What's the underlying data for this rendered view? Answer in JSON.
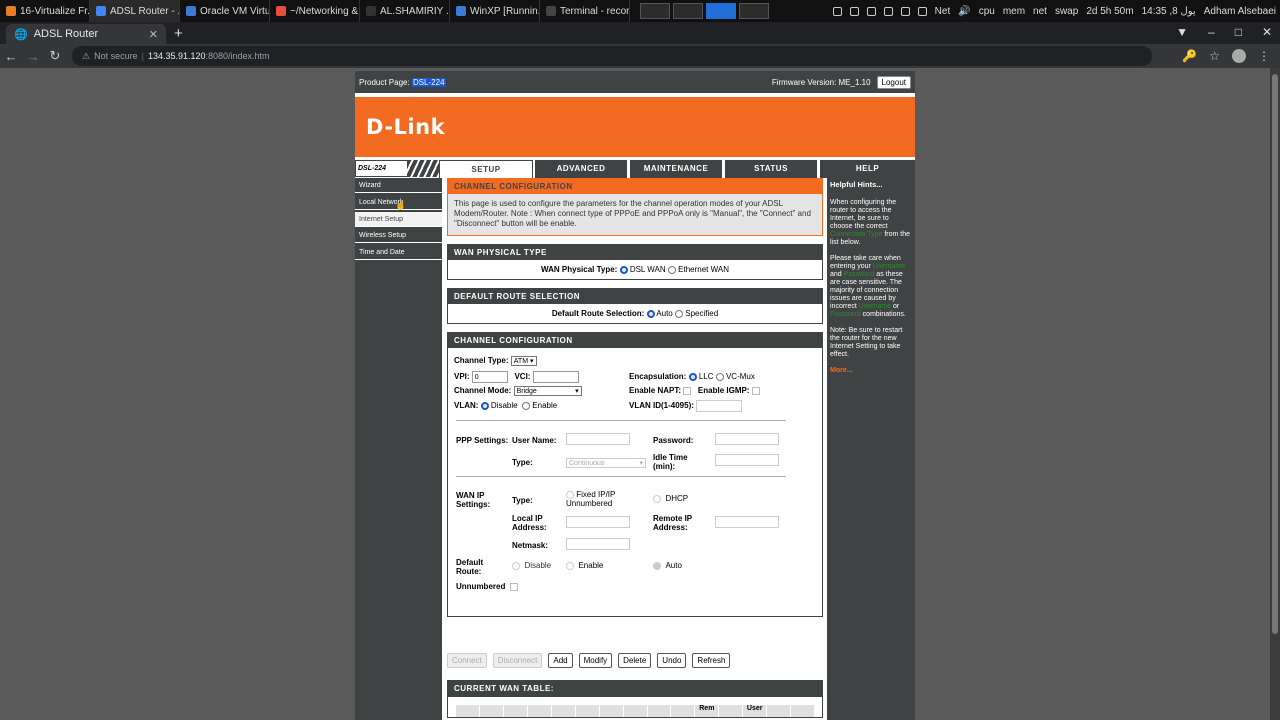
{
  "os_panel": {
    "tasks": [
      {
        "label": "16-Virtualize Fr...",
        "color": "#e67e22"
      },
      {
        "label": "ADSL Router - ...",
        "color": "#4285f4",
        "active": true
      },
      {
        "label": "Oracle VM Virtu...",
        "color": "#3a7bd5"
      },
      {
        "label": "~/Networking &...",
        "color": "#e74c3c"
      },
      {
        "label": "AL.SHAMIRIY ...",
        "color": "#333333"
      },
      {
        "label": "WinXP [Runnin...",
        "color": "#3a7bd5"
      },
      {
        "label": "Terminal - recor...",
        "color": "#444444"
      }
    ],
    "tray": {
      "net": "Net",
      "cpu": "cpu",
      "mem": "mem",
      "net2": "net",
      "swap": "swap",
      "uptime": "2d 5h 50m",
      "clock": "14:35 ,8 يول",
      "user": "Adham Alsebaei"
    }
  },
  "browser": {
    "tab_title": "ADSL Router",
    "security": "Not secure",
    "url_host": "134.35.91.120",
    "url_rest": ":8080/index.htm"
  },
  "router": {
    "product_label": "Product Page:",
    "product": "DSL-224",
    "firmware": "Firmware Version: ME_1.10",
    "logout": "Logout",
    "brand": "D-Link",
    "model": "DSL-224",
    "tabs": [
      "SETUP",
      "ADVANCED",
      "MAINTENANCE",
      "STATUS",
      "HELP"
    ],
    "sidebar": [
      "Wizard",
      "Local Network",
      "Internet Setup",
      "Wireless Setup",
      "Time and Date"
    ],
    "hints": {
      "title": "Helpful Hints...",
      "p1a": "When configuring the router to access the Internet, be sure to choose the correct ",
      "p1link": "Connection Type",
      "p1b": " from the list below.",
      "p2a": "Please take care when entering your ",
      "p2link1": "Username",
      "p2and": " and ",
      "p2link2": "Password",
      "p2b": " as these are case sensitive. The majority of connection issues are caused by incorrect ",
      "p2link3": "Username",
      "p2or": " or ",
      "p2link4": "Password",
      "p2c": " combinations.",
      "p3": "Note: Be sure to restart the router for the new Internet Setting to take effect.",
      "more": "More..."
    },
    "intro": {
      "title": "CHANNEL CONFIGURATION",
      "text": "This page is used to configure the parameters for the channel operation modes of your ADSL Modem/Router. Note : When connect type of PPPoE and PPPoA only is \"Manual\", the \"Connect\" and \"Disconnect\" button will be enable."
    },
    "wan_physical": {
      "title": "WAN PHYSICAL TYPE",
      "label": "WAN Physical Type:",
      "opt1": "DSL WAN",
      "opt2": "Ethernet WAN"
    },
    "default_route": {
      "title": "DEFAULT ROUTE SELECTION",
      "label": "Default Route Selection:",
      "opt1": "Auto",
      "opt2": "Specified"
    },
    "channel": {
      "title": "CHANNEL CONFIGURATION",
      "channel_type_label": "Channel Type:",
      "channel_type": "ATM",
      "vpi_label": "VPI:",
      "vpi": "0",
      "vci_label": "VCI:",
      "vci": "",
      "encap_label": "Encapsulation:",
      "encap1": "LLC",
      "encap2": "VC-Mux",
      "mode_label": "Channel Mode:",
      "mode": "Bridge",
      "napt_label": "Enable NAPT:",
      "igmp_label": "Enable IGMP:",
      "vlan_label": "VLAN:",
      "vlan1": "Disable",
      "vlan2": "Enable",
      "vlanid_label": "VLAN ID(1-4095):",
      "ppp_label": "PPP Settings:",
      "user_label": "User Name:",
      "pass_label": "Password:",
      "type_label": "Type:",
      "ppp_type": "Continuous",
      "idle_label": "Idle Time (min):",
      "wanip_label": "WAN IP Settings:",
      "wtype_label": "Type:",
      "fixed": "Fixed IP/IP Unnumbered",
      "dhcp": "DHCP",
      "local_label": "Local IP Address:",
      "remote_label": "Remote IP Address:",
      "netmask_label": "Netmask:",
      "droute_label": "Default Route:",
      "dr1": "Disable",
      "dr2": "Enable",
      "dr3": "Auto",
      "unnum_label": "Unnumbered"
    },
    "buttons": [
      "Connect",
      "Disconnect",
      "Add",
      "Modify",
      "Delete",
      "Undo",
      "Refresh"
    ],
    "wan_table": {
      "title": "CURRENT WAN TABLE:",
      "headers": [
        "",
        "",
        "",
        "",
        "",
        "",
        "",
        "",
        "",
        "",
        "Rem",
        "",
        "User",
        "",
        ""
      ]
    }
  }
}
